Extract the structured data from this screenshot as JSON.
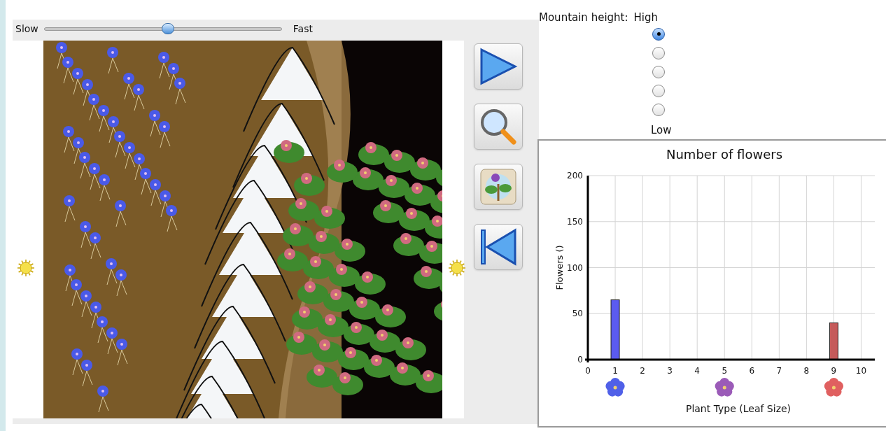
{
  "speed_slider": {
    "min_label": "Slow",
    "max_label": "Fast",
    "level": 0.52
  },
  "mountain_height": {
    "label": "Mountain height:",
    "top_label": "High",
    "bottom_label": "Low",
    "options": [
      {
        "selected": true
      },
      {
        "selected": false
      },
      {
        "selected": false
      },
      {
        "selected": false
      },
      {
        "selected": false
      }
    ]
  },
  "chart": {
    "chart_data": {
      "type": "bar",
      "title": "Number of flowers",
      "xlabel": "Plant Type (Leaf Size)",
      "ylabel": "Flowers ()",
      "x": [
        1,
        9
      ],
      "series": [
        {
          "color": "#5b5bf0",
          "values": [
            65,
            null
          ]
        },
        {
          "color": "#c55a5a",
          "values": [
            null,
            40
          ]
        }
      ],
      "grid": true,
      "xlim": [
        0,
        10.5
      ],
      "ylim": [
        0,
        200
      ],
      "xticks": [
        0,
        1,
        2,
        3,
        4,
        5,
        6,
        7,
        8,
        9,
        10
      ],
      "yticks": [
        0,
        50,
        100,
        150,
        200
      ]
    }
  }
}
